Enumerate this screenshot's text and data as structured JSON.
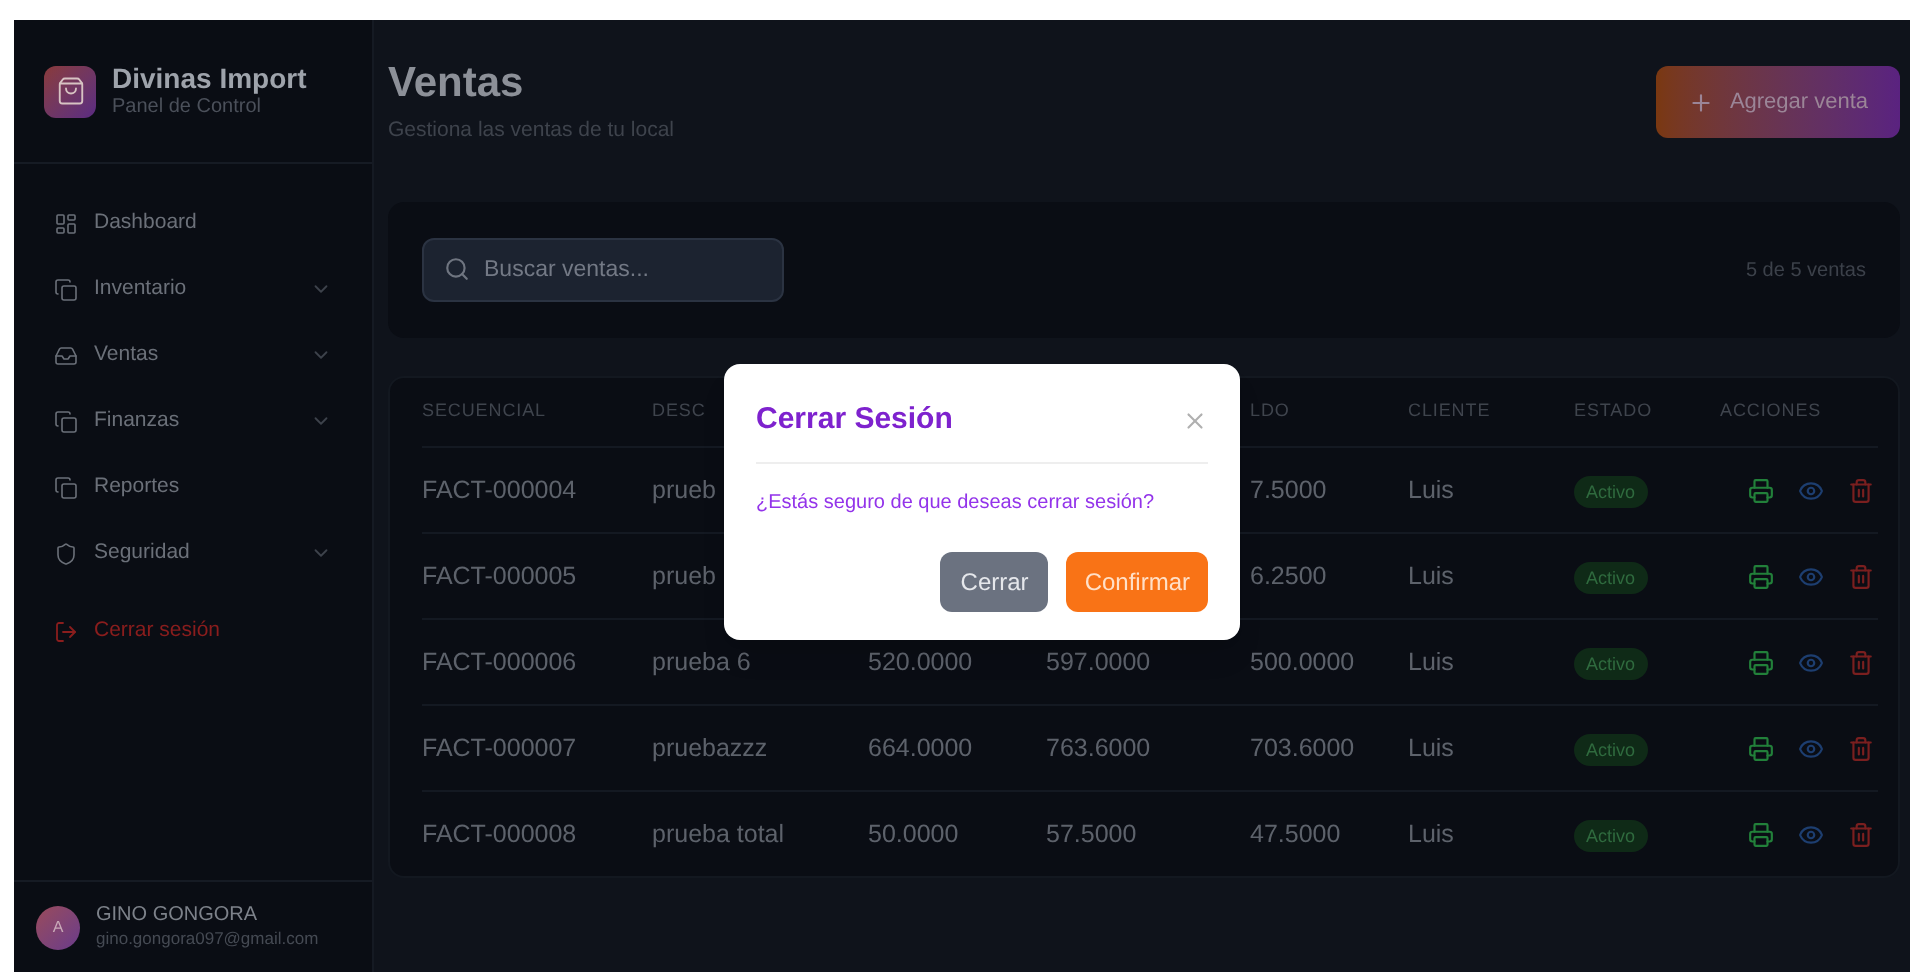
{
  "brand": {
    "title": "Divinas Import",
    "subtitle": "Panel de Control"
  },
  "sidebar": {
    "items": [
      {
        "label": "Dashboard",
        "expandable": false
      },
      {
        "label": "Inventario",
        "expandable": true
      },
      {
        "label": "Ventas",
        "expandable": true
      },
      {
        "label": "Finanzas",
        "expandable": true
      },
      {
        "label": "Reportes",
        "expandable": false
      },
      {
        "label": "Seguridad",
        "expandable": true
      }
    ],
    "logout": "Cerrar sesión"
  },
  "user": {
    "initial": "A",
    "name": "GINO GONGORA",
    "email": "gino.gongora097@gmail.com"
  },
  "page": {
    "title": "Ventas",
    "subtitle": "Gestiona las ventas de tu local",
    "add_button": "Agregar venta"
  },
  "search": {
    "placeholder": "Buscar ventas...",
    "count": "5 de 5 ventas"
  },
  "table": {
    "columns": [
      "SECUENCIAL",
      "DESC",
      null,
      null,
      "LDO",
      "CLIENTE",
      "ESTADO",
      "ACCIONES"
    ],
    "rows": [
      {
        "cells": [
          "FACT-000004",
          "prueb",
          null,
          null,
          "7.5000",
          "Luis"
        ],
        "status": "Activo"
      },
      {
        "cells": [
          "FACT-000005",
          "prueb",
          null,
          null,
          "6.2500",
          "Luis"
        ],
        "status": "Activo"
      },
      {
        "cells": [
          "FACT-000006",
          "prueba 6",
          "520.0000",
          "597.0000",
          "500.0000",
          "Luis"
        ],
        "status": "Activo"
      },
      {
        "cells": [
          "FACT-000007",
          "pruebazzz",
          "664.0000",
          "763.6000",
          "703.6000",
          "Luis"
        ],
        "status": "Activo"
      },
      {
        "cells": [
          "FACT-000008",
          "prueba total",
          "50.0000",
          "57.5000",
          "47.5000",
          "Luis"
        ],
        "status": "Activo"
      }
    ]
  },
  "dialog": {
    "title": "Cerrar Sesión",
    "message": "¿Estás seguro de que deseas cerrar sesión?",
    "buttons": [
      {
        "label": "Cerrar",
        "kind": "secondary"
      },
      {
        "label": "Confirmar",
        "kind": "primary"
      }
    ]
  }
}
